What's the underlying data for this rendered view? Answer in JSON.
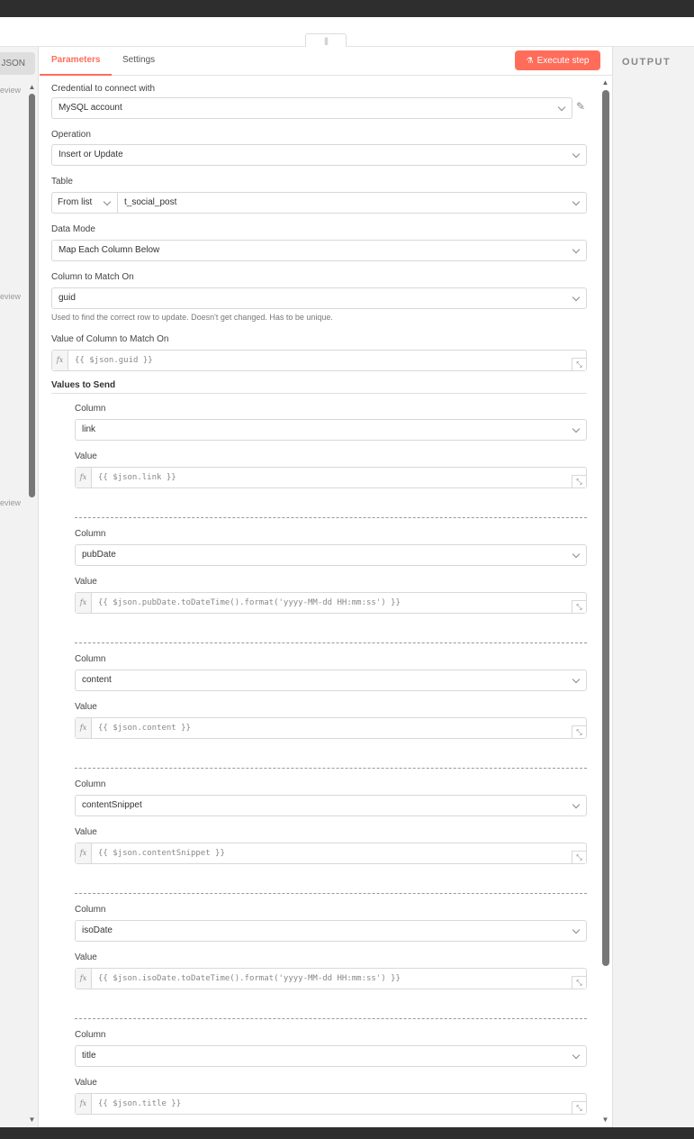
{
  "header": {
    "drag_handle": "|||"
  },
  "left_panel": {
    "tab_label": "JSON",
    "preview_labels": [
      "eview",
      "eview",
      "eview"
    ]
  },
  "right_panel": {
    "title": "OUTPUT"
  },
  "tabs": {
    "parameters": "Parameters",
    "settings": "Settings"
  },
  "execute_button": {
    "label": "Execute step",
    "icon": "flask-icon"
  },
  "fields": {
    "credential": {
      "label": "Credential to connect with",
      "value": "MySQL account"
    },
    "operation": {
      "label": "Operation",
      "value": "Insert or Update"
    },
    "table": {
      "label": "Table",
      "mode": "From list",
      "value": "t_social_post"
    },
    "data_mode": {
      "label": "Data Mode",
      "value": "Map Each Column Below"
    },
    "match_column": {
      "label": "Column to Match On",
      "value": "guid",
      "hint": "Used to find the correct row to update. Doesn't get changed. Has to be unique."
    },
    "match_value": {
      "label": "Value of Column to Match On",
      "value": "{{ $json.guid }}"
    },
    "values_to_send": {
      "label": "Values to Send"
    }
  },
  "column_label": "Column",
  "value_label": "Value",
  "fx_label": "fx",
  "mappings": [
    {
      "column": "link",
      "value": "{{ $json.link }}"
    },
    {
      "column": "pubDate",
      "value": "{{ $json.pubDate.toDateTime().format('yyyy-MM-dd HH:mm:ss') }}"
    },
    {
      "column": "content",
      "value": "{{ $json.content }}"
    },
    {
      "column": "contentSnippet",
      "value": "{{ $json.contentSnippet }}"
    },
    {
      "column": "isoDate",
      "value": "{{ $json.isoDate.toDateTime().format('yyyy-MM-dd HH:mm:ss') }}"
    },
    {
      "column": "title",
      "value": "{{ $json.title }}"
    }
  ]
}
